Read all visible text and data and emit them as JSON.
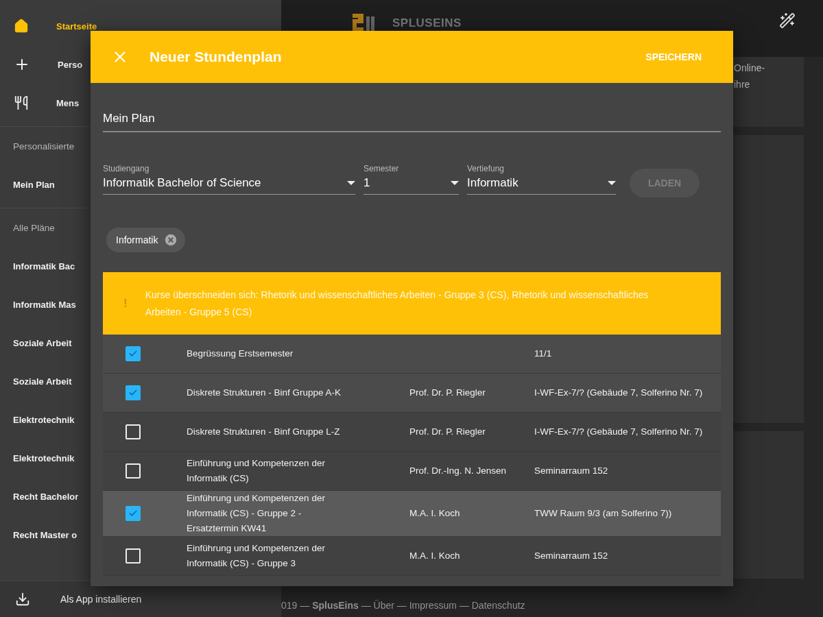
{
  "sidebar": {
    "nav": [
      {
        "label": "Startseite",
        "kind": "home",
        "selected": true
      },
      {
        "label": "Perso",
        "kind": "add",
        "selected": false
      },
      {
        "label": "Mens",
        "kind": "food",
        "selected": false
      }
    ],
    "sections": [
      {
        "title": "Personalisierte",
        "items": [
          "Mein Plan"
        ]
      },
      {
        "title": "Alle Pläne",
        "items": [
          "Informatik Bac",
          "Informatik Mas",
          "Soziale Arbeit",
          "Soziale Arbeit",
          "Elektrotechnik",
          "Elektrotechnik",
          "Recht Bachelor",
          "Recht Master o"
        ]
      }
    ],
    "install": {
      "label": "Als App installieren"
    }
  },
  "header": {
    "logo_text": "SPLUSEINS"
  },
  "background_card": {
    "lines": [
      "Online-",
      "ihre"
    ]
  },
  "footer": "019 — **SplusEins** — Über — Impressum — Datenschutz",
  "dialog": {
    "title": "Neuer Stundenplan",
    "save_label": "SPEICHERN",
    "name_field": {
      "value": "Mein Plan"
    },
    "selects": [
      {
        "label": "Studiengang",
        "value": "Informatik Bachelor of Science"
      },
      {
        "label": "Semester",
        "value": "1"
      },
      {
        "label": "Vertiefung",
        "value": "Informatik"
      }
    ],
    "load_button": {
      "label": "LADEN",
      "disabled": true
    },
    "chips": [
      {
        "label": "Informatik"
      }
    ],
    "warning": {
      "icon": "!",
      "text": "Kurse überschneiden sich: Rhetorik und wissenschaftliches Arbeiten - Gruppe 3 (CS), Rhetorik und wissenschaftliches Arbeiten - Gruppe 5 (CS)"
    },
    "courses": [
      {
        "checked": true,
        "highlighted": false,
        "title": "Begrüssung Erstsemester",
        "room": "11/1"
      },
      {
        "checked": true,
        "highlighted": false,
        "title": "Diskrete Strukturen - Binf Gruppe A-K",
        "lecturer": "Prof. Dr. P. Riegler",
        "room": "I-WF-Ex-7/? (Gebäude 7, Solferino Nr. 7)"
      },
      {
        "checked": false,
        "highlighted": false,
        "title": "Diskrete Strukturen - Binf Gruppe L-Z",
        "lecturer": "Prof. Dr. P. Riegler",
        "room": "I-WF-Ex-7/? (Gebäude 7, Solferino Nr. 7)"
      },
      {
        "checked": false,
        "highlighted": false,
        "title": "Einführung und Kompetenzen der Informatik (CS)",
        "lecturer": "Prof. Dr.-Ing. N. Jensen",
        "room": "Seminarraum 152"
      },
      {
        "checked": true,
        "highlighted": true,
        "title": "Einführung und Kompetenzen der Informatik (CS) - Gruppe 2 - Ersatztermin KW41",
        "lecturer": "M.A. I. Koch",
        "room": "TWW Raum 9/3 (am Solferino 7))"
      },
      {
        "checked": false,
        "highlighted": false,
        "title": "Einführung und Kompetenzen der Informatik (CS) - Gruppe 3",
        "lecturer": "M.A. I. Koch",
        "room": "Seminarraum 152"
      }
    ]
  }
}
